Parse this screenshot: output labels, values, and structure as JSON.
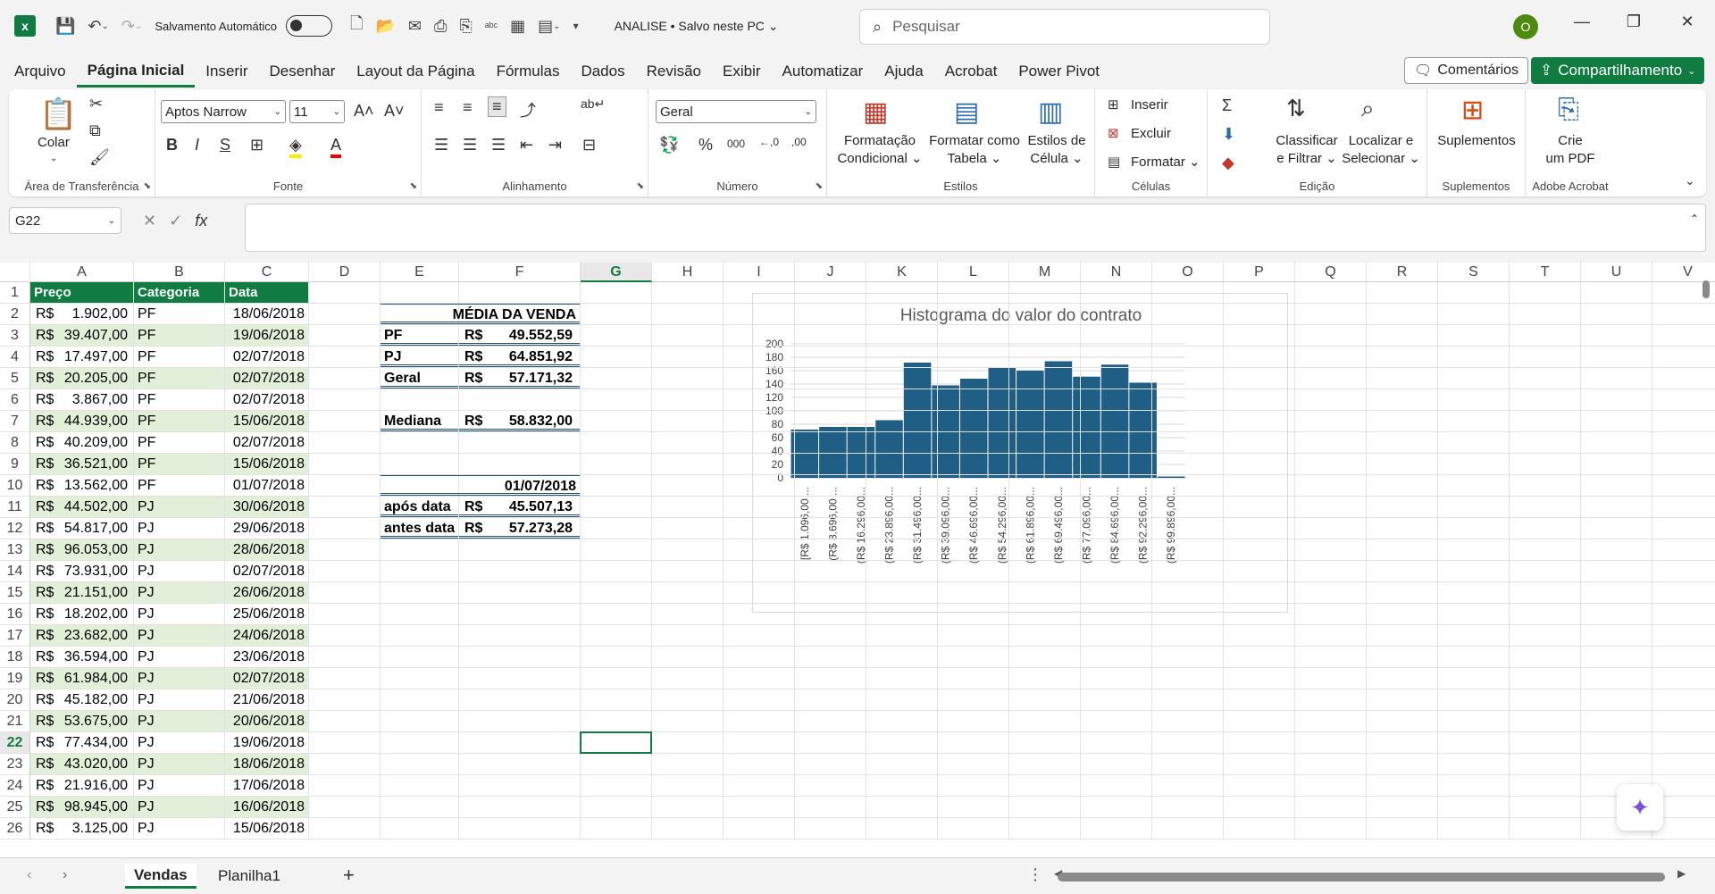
{
  "titlebar": {
    "autosave_label": "Salvamento Automático",
    "doc_title": "ANALISE • Salvo neste PC ⌄",
    "search_placeholder": "Pesquisar",
    "avatar_letter": "O"
  },
  "menu": {
    "items": [
      "Arquivo",
      "Página Inicial",
      "Inserir",
      "Desenhar",
      "Layout da Página",
      "Fórmulas",
      "Dados",
      "Revisão",
      "Exibir",
      "Automatizar",
      "Ajuda",
      "Acrobat",
      "Power Pivot"
    ],
    "active_index": 1,
    "comments_label": "Comentários",
    "share_label": "Compartilhamento"
  },
  "ribbon": {
    "paste_label": "Colar",
    "clipboard_group": "Área de Transferência",
    "font_name": "Aptos Narrow",
    "font_size": "11",
    "font_group": "Fonte",
    "alignment_group": "Alinhamento",
    "number_format": "Geral",
    "number_group": "Número",
    "cond_format": "Formatação\nCondicional ⌄",
    "format_table": "Formatar como\nTabela ⌄",
    "cell_styles": "Estilos de\nCélula ⌄",
    "styles_group": "Estilos",
    "insert_label": "Inserir",
    "delete_label": "Excluir",
    "format_label": "Formatar ⌄",
    "cells_group": "Células",
    "sort_filter": "Classificar\ne Filtrar ⌄",
    "find_select": "Localizar e\nSelecionar ⌄",
    "editing_group": "Edição",
    "addins_label": "Suplementos",
    "addins_group": "Suplementos",
    "create_pdf": "Crie\num PDF",
    "acrobat_group": "Adobe Acrobat"
  },
  "formula_bar": {
    "name_box": "G22",
    "fx": "fx",
    "value": ""
  },
  "columns": [
    "A",
    "B",
    "C",
    "D",
    "E",
    "F",
    "G",
    "H",
    "I",
    "J",
    "K",
    "L",
    "M",
    "N",
    "O",
    "P",
    "Q",
    "R",
    "S",
    "T",
    "U",
    "V"
  ],
  "selected_column": "G",
  "selected_row": 22,
  "table": {
    "headers": [
      "Preço",
      "Categoria",
      "Data"
    ],
    "rows": [
      [
        "R$",
        "1.902,00",
        "PF",
        "18/06/2018"
      ],
      [
        "R$",
        "39.407,00",
        "PF",
        "19/06/2018"
      ],
      [
        "R$",
        "17.497,00",
        "PF",
        "02/07/2018"
      ],
      [
        "R$",
        "20.205,00",
        "PF",
        "02/07/2018"
      ],
      [
        "R$",
        "3.867,00",
        "PF",
        "02/07/2018"
      ],
      [
        "R$",
        "44.939,00",
        "PF",
        "15/06/2018"
      ],
      [
        "R$",
        "40.209,00",
        "PF",
        "02/07/2018"
      ],
      [
        "R$",
        "36.521,00",
        "PF",
        "15/06/2018"
      ],
      [
        "R$",
        "13.562,00",
        "PF",
        "01/07/2018"
      ],
      [
        "R$",
        "44.502,00",
        "PJ",
        "30/06/2018"
      ],
      [
        "R$",
        "54.817,00",
        "PJ",
        "29/06/2018"
      ],
      [
        "R$",
        "96.053,00",
        "PJ",
        "28/06/2018"
      ],
      [
        "R$",
        "73.931,00",
        "PJ",
        "02/07/2018"
      ],
      [
        "R$",
        "21.151,00",
        "PJ",
        "26/06/2018"
      ],
      [
        "R$",
        "18.202,00",
        "PJ",
        "25/06/2018"
      ],
      [
        "R$",
        "23.682,00",
        "PJ",
        "24/06/2018"
      ],
      [
        "R$",
        "36.594,00",
        "PJ",
        "23/06/2018"
      ],
      [
        "R$",
        "61.984,00",
        "PJ",
        "02/07/2018"
      ],
      [
        "R$",
        "45.182,00",
        "PJ",
        "21/06/2018"
      ],
      [
        "R$",
        "53.675,00",
        "PJ",
        "20/06/2018"
      ],
      [
        "R$",
        "77.434,00",
        "PJ",
        "19/06/2018"
      ],
      [
        "R$",
        "43.020,00",
        "PJ",
        "18/06/2018"
      ],
      [
        "R$",
        "21.916,00",
        "PJ",
        "17/06/2018"
      ],
      [
        "R$",
        "98.945,00",
        "PJ",
        "16/06/2018"
      ],
      [
        "R$",
        "3.125,00",
        "PJ",
        "15/06/2018"
      ]
    ]
  },
  "stats": {
    "title": "MÉDIA DA VENDA",
    "pf_label": "PF",
    "pf_cur": "R$",
    "pf_value": "49.552,59",
    "pj_label": "PJ",
    "pj_cur": "R$",
    "pj_value": "64.851,92",
    "geral_label": "Geral",
    "geral_cur": "R$",
    "geral_value": "57.171,32",
    "mediana_label": "Mediana",
    "mediana_cur": "R$",
    "mediana_value": "58.832,00",
    "date_value": "01/07/2018",
    "apos_label": "após data",
    "apos_cur": "R$",
    "apos_value": "45.507,13",
    "antes_label": "antes data",
    "antes_cur": "R$",
    "antes_value": "57.273,28"
  },
  "chart_data": {
    "type": "bar",
    "title": "Histograma do valor do contrato",
    "categories": [
      "[R$ 1.096,00 ...",
      "(R$ 8.696,00 ...",
      "(R$ 16.296,00...",
      "(R$ 23.896,00...",
      "(R$ 31.496,00...",
      "(R$ 39.096,00...",
      "(R$ 46.696,00...",
      "(R$ 54.296,00...",
      "(R$ 61.896,00...",
      "(R$ 69.496,00...",
      "(R$ 77.096,00...",
      "(R$ 84.696,00...",
      "(R$ 92.296,00...",
      "(R$ 99.896,00..."
    ],
    "values": [
      72,
      76,
      76,
      86,
      172,
      138,
      148,
      164,
      160,
      174,
      151,
      169,
      142,
      2
    ],
    "ylim": [
      0,
      200
    ],
    "yticks": [
      "200",
      "180",
      "160",
      "140",
      "120",
      "100",
      "80",
      "60",
      "40",
      "20",
      "0"
    ],
    "bar_color": "#1f5f86",
    "grid": true
  },
  "sheets": {
    "tabs": [
      "Vendas",
      "Planilha1"
    ],
    "active": "Vendas"
  }
}
